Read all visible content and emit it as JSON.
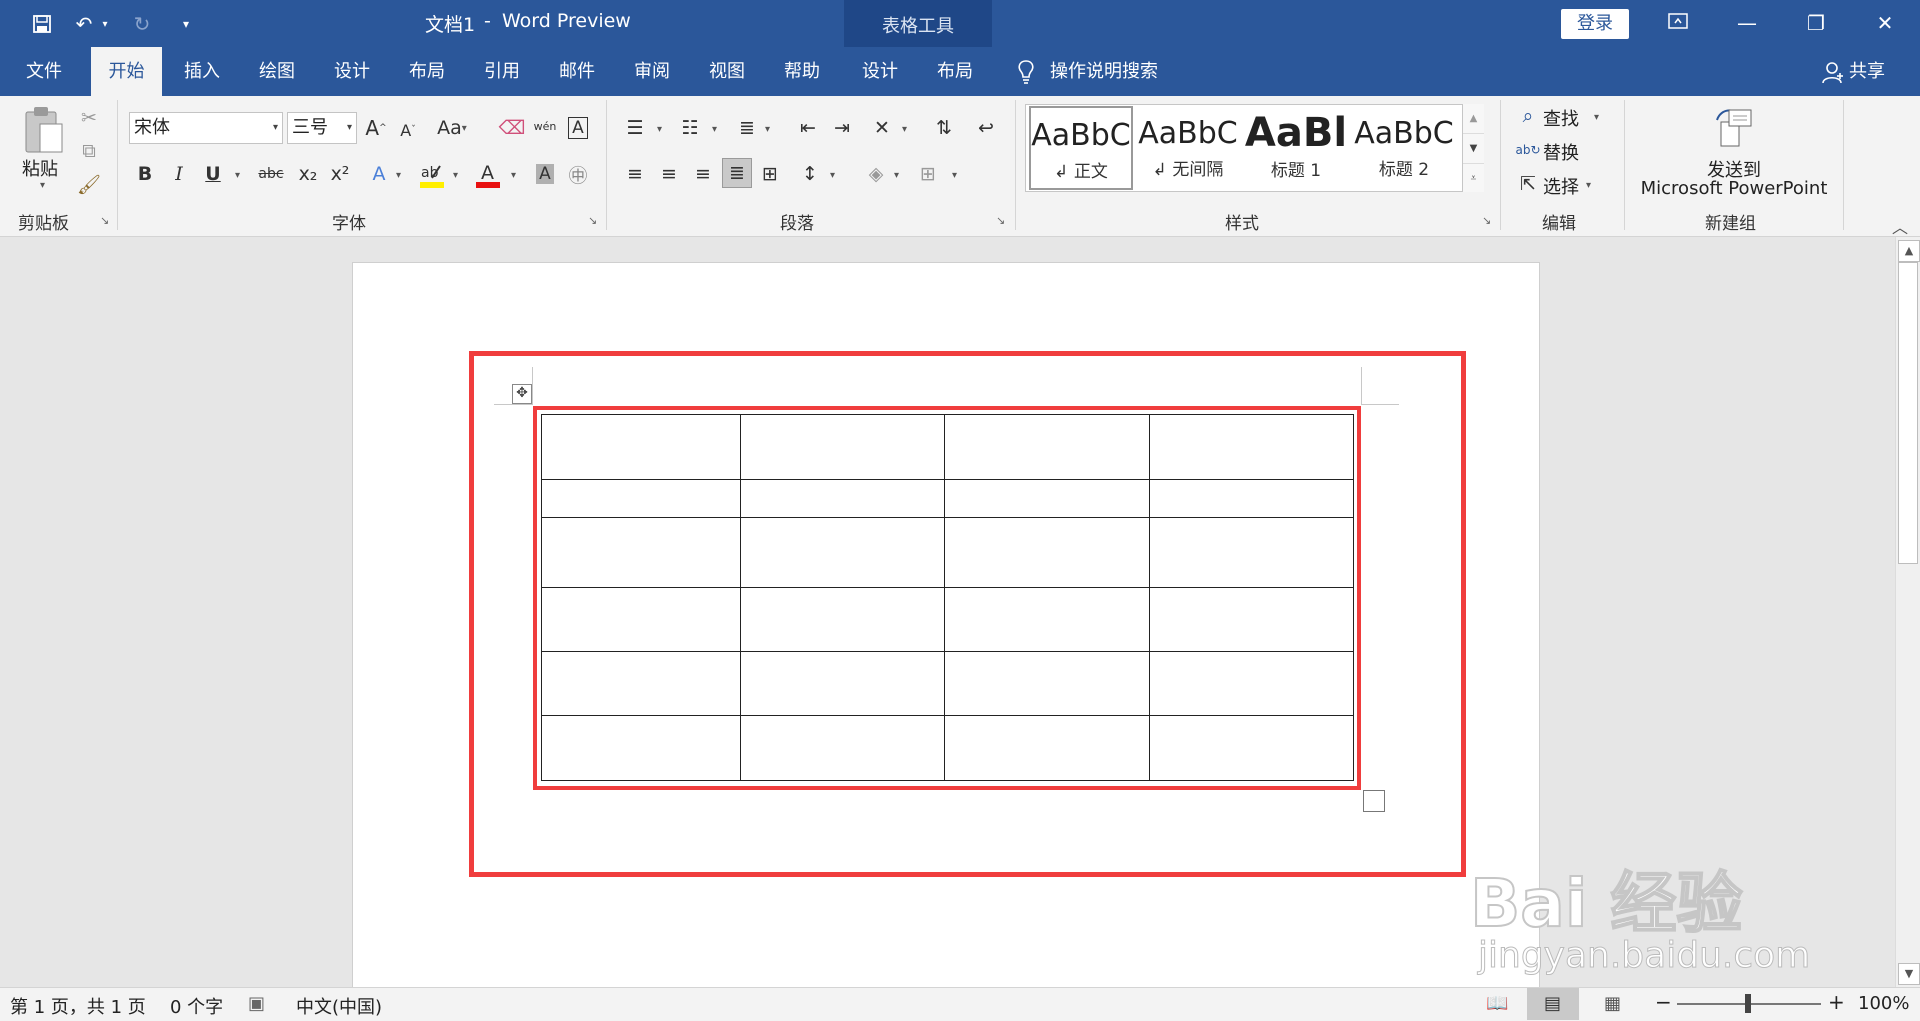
{
  "window": {
    "doc_name": "文档1",
    "separator": "-",
    "app_name": "Word Preview",
    "context_group": "表格工具",
    "login_label": "登录"
  },
  "tabs": [
    {
      "label": "文件"
    },
    {
      "label": "开始"
    },
    {
      "label": "插入"
    },
    {
      "label": "绘图"
    },
    {
      "label": "设计"
    },
    {
      "label": "布局"
    },
    {
      "label": "引用"
    },
    {
      "label": "邮件"
    },
    {
      "label": "审阅"
    },
    {
      "label": "视图"
    },
    {
      "label": "帮助"
    },
    {
      "label": "设计"
    },
    {
      "label": "布局"
    }
  ],
  "active_tab": "开始",
  "tell_me": "操作说明搜索",
  "share": "共享",
  "ribbon": {
    "clipboard": {
      "label": "剪贴板",
      "paste": "粘贴"
    },
    "font": {
      "label": "字体",
      "font_name": "宋体",
      "font_size": "三号",
      "case_btn": "Aa",
      "bold": "B",
      "italic": "I",
      "underline": "U",
      "strike": "abc",
      "subscript": "x₂",
      "superscript": "x²",
      "grow": "A",
      "shrink": "A",
      "phonetic": "wén",
      "font_color_letter": "A"
    },
    "paragraph": {
      "label": "段落"
    },
    "styles": {
      "label": "样式",
      "items": [
        {
          "sample": "AaBbC",
          "name": "正文"
        },
        {
          "sample": "AaBbC",
          "name": "无间隔"
        },
        {
          "sample": "AaBl",
          "name": "标题 1"
        },
        {
          "sample": "AaBbC",
          "name": "标题 2"
        }
      ]
    },
    "editing": {
      "label": "编辑",
      "find": "查找",
      "replace": "替换",
      "select": "选择"
    },
    "newgroup": {
      "label": "新建组",
      "send_line1": "发送到",
      "send_line2": "Microsoft PowerPoint"
    }
  },
  "table": {
    "rows": 6,
    "cols": 4
  },
  "status": {
    "page": "第 1 页，共 1 页",
    "words": "0 个字",
    "lang": "中文(中国)",
    "zoom": "100%",
    "zoom_minus": "−",
    "zoom_plus": "+"
  },
  "watermark": {
    "main": "Bai 经验",
    "sub": "jingyan.baidu.com"
  },
  "colors": {
    "titlebar": "#2b579a",
    "context_band": "#1f4787",
    "highlight": "#f03d3d"
  }
}
